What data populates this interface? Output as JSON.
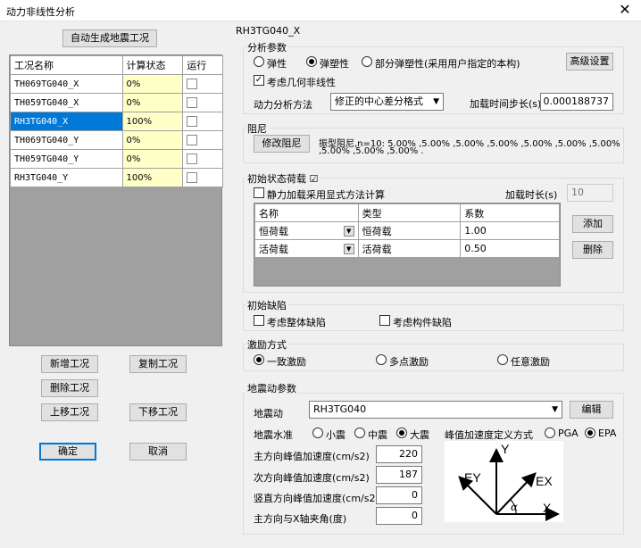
{
  "window": {
    "title": "动力非线性分析",
    "close": "✕"
  },
  "left": {
    "auto_gen_label": "自动生成地震工况",
    "columns": [
      "工况名称",
      "计算状态",
      "运行"
    ],
    "rows": [
      {
        "name": "TH069TG040_X",
        "status": "0%"
      },
      {
        "name": "TH059TG040_X",
        "status": "0%"
      },
      {
        "name": "RH3TG040_X",
        "status": "100%"
      },
      {
        "name": "TH069TG040_Y",
        "status": "0%"
      },
      {
        "name": "TH059TG040_Y",
        "status": "0%"
      },
      {
        "name": "RH3TG040_Y",
        "status": "100%"
      }
    ],
    "add_label": "新增工况",
    "copy_label": "复制工况",
    "delete_label": "删除工况",
    "up_label": "上移工况",
    "down_label": "下移工况",
    "ok_label": "确定",
    "cancel_label": "取消"
  },
  "right": {
    "case_title": "RH3TG040_X",
    "analysis": {
      "group_label": "分析参数",
      "elastic": "弹性",
      "plastic": "弹塑性",
      "partial": "部分弹塑性(采用用户指定的本构)",
      "advanced_label": "高级设置",
      "geo_nonlinear": "考虑几何非线性",
      "method_label": "动力分析方法",
      "method_value": "修正的中心差分格式",
      "step_label": "加载时间步长(s)",
      "step_value": "0.000188737"
    },
    "damping": {
      "group_label": "阻尼",
      "modify_label": "修改阻尼",
      "text_line1": "振型阻尼,n=10: 5.00% ,5.00% ,5.00% ,5.00% ,5.00% ,5.00% ,5.00%",
      "text_line2": ",5.00% ,5.00% ,5.00% ."
    },
    "initial_load": {
      "group_label": "初始状态荷载",
      "group_check": "☑",
      "explicit_label": "静力加载采用显式方法计算",
      "duration_label": "加载时长(s)",
      "duration_value": "10",
      "columns": [
        "名称",
        "类型",
        "系数"
      ],
      "rows": [
        {
          "name": "恒荷载",
          "type": "恒荷载",
          "coef": "1.00"
        },
        {
          "name": "活荷载",
          "type": "活荷载",
          "coef": "0.50"
        }
      ],
      "add_label": "添加",
      "delete_label": "删除"
    },
    "defects": {
      "group_label": "初始缺陷",
      "global_label": "考虑整体缺陷",
      "member_label": "考虑构件缺陷"
    },
    "excitation": {
      "group_label": "激励方式",
      "uniform": "一致激励",
      "multi": "多点激励",
      "arbitrary": "任意激励"
    },
    "ground_motion": {
      "group_label": "地震动参数",
      "motion_label": "地震动",
      "motion_value": "RH3TG040",
      "edit_label": "编辑",
      "level_label": "地震水准",
      "small": "小震",
      "medium": "中震",
      "large": "大震",
      "peak_def_label": "峰值加速度定义方式",
      "pga": "PGA",
      "epa": "EPA",
      "main_label": "主方向峰值加速度(cm/s2)",
      "main_value": "220",
      "second_label": "次方向峰值加速度(cm/s2)",
      "second_value": "187",
      "vertical_label": "竖直方向峰值加速度(cm/s2)",
      "vertical_value": "0",
      "angle_label": "主方向与X轴夹角(度)",
      "angle_value": "0",
      "diagram": {
        "y": "Y",
        "x": "X",
        "ey": "EY",
        "ex": "EX",
        "alpha": "α"
      }
    }
  }
}
